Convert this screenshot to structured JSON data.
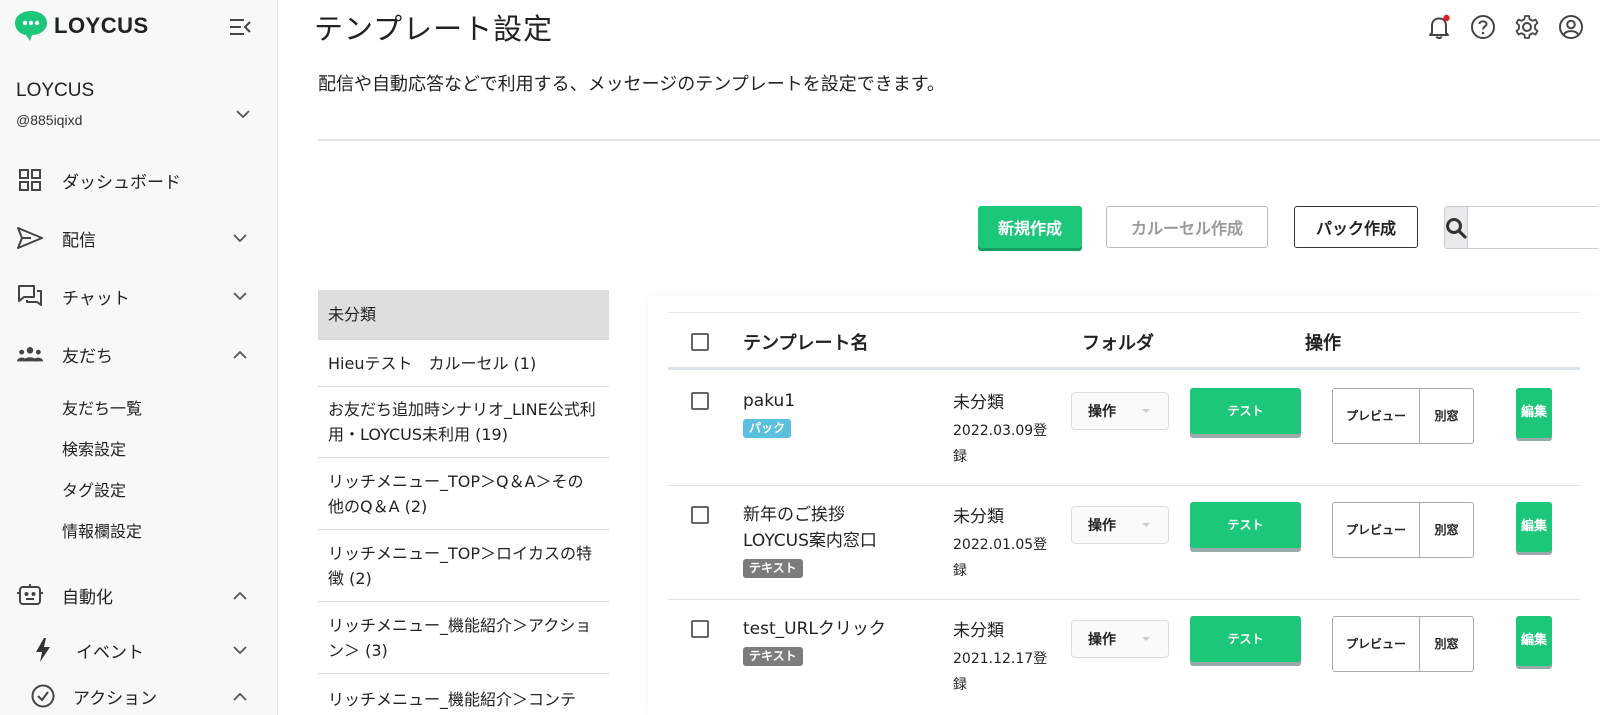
{
  "brand": {
    "logo_text": "LOYCUS",
    "accent": "#1dc77a"
  },
  "account": {
    "name": "LOYCUS",
    "id": "@885iqixd"
  },
  "sidebar": {
    "items": [
      {
        "label": "ダッシュボード",
        "icon": "grid-icon"
      },
      {
        "label": "配信",
        "icon": "send-icon"
      },
      {
        "label": "チャット",
        "icon": "chat-icon"
      },
      {
        "label": "友だち",
        "icon": "people-icon"
      },
      {
        "label": "自動化",
        "icon": "robot-icon"
      },
      {
        "label": "イベント",
        "icon": "bolt-icon"
      },
      {
        "label": "アクション",
        "icon": "check-circle-icon"
      }
    ],
    "friends_sub": [
      "友だち一覧",
      "検索設定",
      "タグ設定",
      "情報欄設定"
    ]
  },
  "header": {
    "title": "テンプレート設定",
    "description": "配信や自動応答などで利用する、メッセージのテンプレートを設定できます。"
  },
  "toolbar": {
    "new_label": "新規作成",
    "carousel_label": "カルーセル作成",
    "pack_label": "パック作成",
    "search_placeholder": ""
  },
  "folders": [
    "未分類",
    "Hieuテスト　カルーセル (1)",
    "お友だち追加時シナリオ_LINE公式利用・LOYCUS未利用 (19)",
    "リッチメニュー_TOP＞Q＆A＞その他のQ＆A (2)",
    "リッチメニュー_TOP＞ロイカスの特徴 (2)",
    "リッチメニュー_機能紹介＞アクション＞ (3)",
    "リッチメニュー_機能紹介＞コンテ"
  ],
  "table": {
    "headers": {
      "name": "テンプレート名",
      "folder": "フォルダ",
      "ops": "操作"
    },
    "rows": [
      {
        "name": "paku1",
        "badge": "パック",
        "badge_type": "pack",
        "folder": "未分類",
        "date": "2022.03.09登録"
      },
      {
        "name": "新年のご挨拶LOYCUS案内窓口",
        "badge": "テキスト",
        "badge_type": "text",
        "folder": "未分類",
        "date": "2022.01.05登録"
      },
      {
        "name": "test_URLクリック",
        "badge": "テキスト",
        "badge_type": "text",
        "folder": "未分類",
        "date": "2021.12.17登録"
      }
    ],
    "op_select_label": "操作",
    "test_label": "テスト",
    "preview_label": "プレビュー",
    "window_label": "別窓",
    "edit_label": "編集"
  }
}
